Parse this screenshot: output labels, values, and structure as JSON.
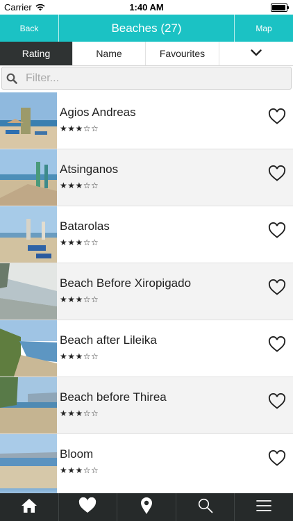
{
  "status_bar": {
    "carrier": "Carrier",
    "time": "1:40 AM"
  },
  "nav": {
    "back_label": "Back",
    "title": "Beaches (27)",
    "map_label": "Map"
  },
  "sort_tabs": [
    {
      "label": "Rating",
      "active": true
    },
    {
      "label": "Name",
      "active": false
    },
    {
      "label": "Favourites",
      "active": false
    }
  ],
  "search": {
    "placeholder": "Filter..."
  },
  "beaches": [
    {
      "name": "Agios Andreas",
      "rating": "★★★☆☆"
    },
    {
      "name": "Atsinganos",
      "rating": "★★★☆☆"
    },
    {
      "name": "Batarolas",
      "rating": "★★★☆☆"
    },
    {
      "name": "Beach Before Xiropigado",
      "rating": "★★★☆☆"
    },
    {
      "name": "Beach after Lileika",
      "rating": "★★★☆☆"
    },
    {
      "name": "Beach before Thirea",
      "rating": "★★★☆☆"
    },
    {
      "name": "Bloom",
      "rating": "★★★☆☆"
    }
  ],
  "tab_bar_icons": [
    "home-icon",
    "heart-icon",
    "map-pin-icon",
    "search-icon",
    "menu-icon"
  ],
  "colors": {
    "accent": "#1bc2c4",
    "dark": "#262a2a",
    "active_tab": "#2f3333"
  }
}
